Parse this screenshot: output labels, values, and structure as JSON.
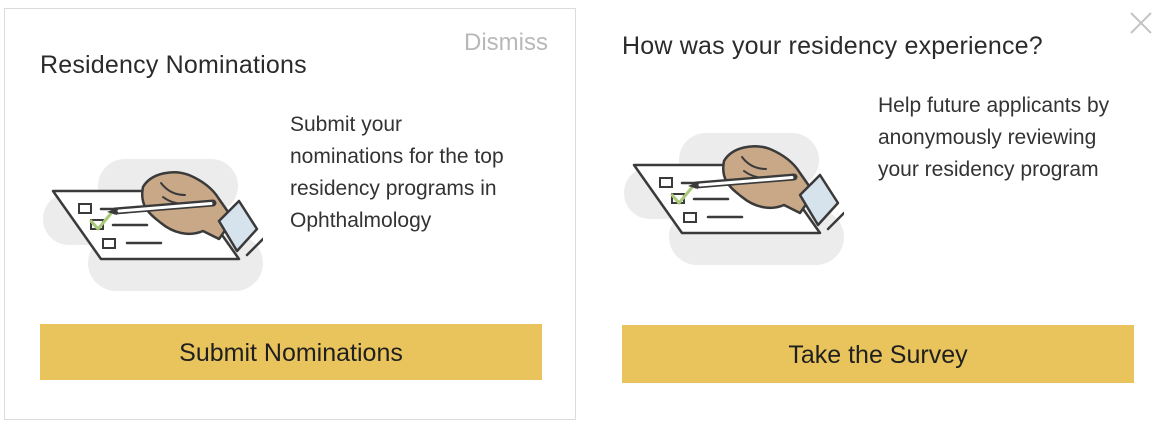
{
  "nominations_card": {
    "title": "Residency Nominations",
    "dismiss_label": "Dismiss",
    "description": "Submit your nominations for the top residency programs in Ophthalmology",
    "button_label": "Submit Nominations",
    "illustration_icon": "checklist-pen-hand-icon"
  },
  "survey_card": {
    "title": "How was your residency experience?",
    "close_icon": "close-icon",
    "description": "Help future applicants by anonymously reviewing your residency program",
    "button_label": "Take the Survey",
    "illustration_icon": "checklist-pen-hand-icon"
  },
  "colors": {
    "button_background": "#e9c45c",
    "dismiss_text": "#b8b8b8",
    "card_border": "#dcdcdc",
    "check_mark": "#a9c97a",
    "hand_skin": "#c9a888",
    "blob_background": "#ececec"
  }
}
